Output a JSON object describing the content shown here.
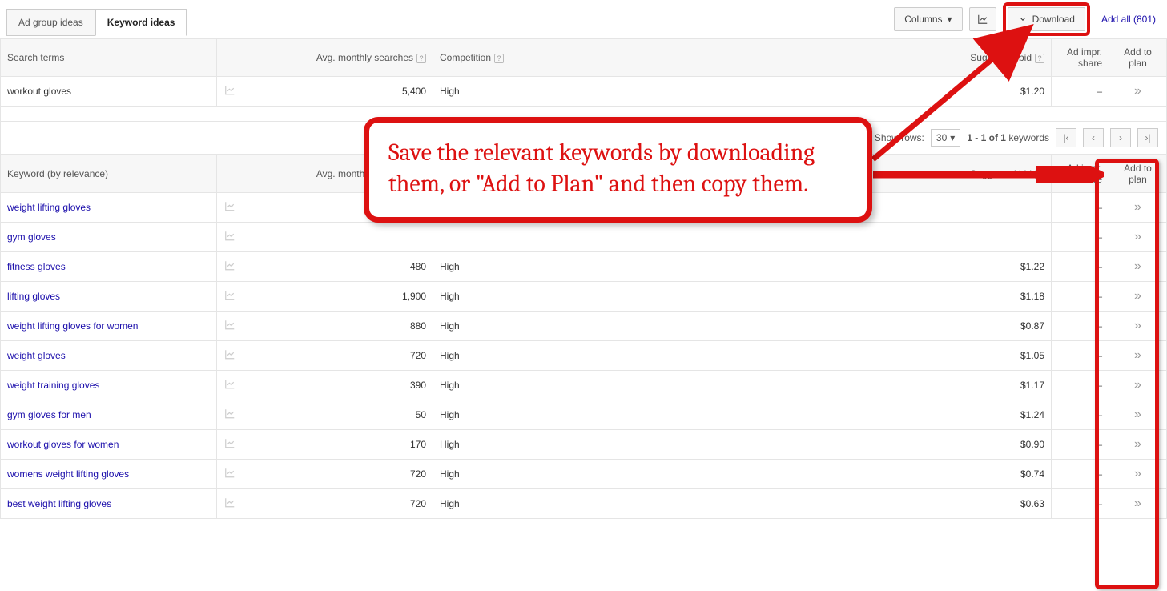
{
  "toolbar": {
    "tabs": {
      "ad_group": "Ad group ideas",
      "keyword": "Keyword ideas"
    },
    "columns_label": "Columns",
    "download_label": "Download",
    "add_all_label": "Add all (801)"
  },
  "headers": {
    "search_terms": "Search terms",
    "keyword_rel": "Keyword (by relevance)",
    "avg_searches": "Avg. monthly searches",
    "competition": "Competition",
    "suggested_bid": "Suggested bid",
    "ad_impr": "Ad impr. share",
    "add_to_plan": "Add to plan"
  },
  "search_terms_rows": [
    {
      "keyword": "workout gloves",
      "searches": "5,400",
      "competition": "High",
      "bid": "$1.20",
      "impr": "–"
    }
  ],
  "pager": {
    "show_rows_label": "Show rows:",
    "rows_value": "30",
    "range_text": "1 - 1 of 1",
    "suffix": "keywords"
  },
  "keyword_rows": [
    {
      "keyword": "weight lifting gloves",
      "searches": "",
      "competition": "",
      "bid": "",
      "impr": "–"
    },
    {
      "keyword": "gym gloves",
      "searches": "",
      "competition": "",
      "bid": "",
      "impr": "–"
    },
    {
      "keyword": "fitness gloves",
      "searches": "480",
      "competition": "High",
      "bid": "$1.22",
      "impr": "–"
    },
    {
      "keyword": "lifting gloves",
      "searches": "1,900",
      "competition": "High",
      "bid": "$1.18",
      "impr": "–"
    },
    {
      "keyword": "weight lifting gloves for women",
      "searches": "880",
      "competition": "High",
      "bid": "$0.87",
      "impr": "–"
    },
    {
      "keyword": "weight gloves",
      "searches": "720",
      "competition": "High",
      "bid": "$1.05",
      "impr": "–"
    },
    {
      "keyword": "weight training gloves",
      "searches": "390",
      "competition": "High",
      "bid": "$1.17",
      "impr": "–"
    },
    {
      "keyword": "gym gloves for men",
      "searches": "50",
      "competition": "High",
      "bid": "$1.24",
      "impr": "–"
    },
    {
      "keyword": "workout gloves for women",
      "searches": "170",
      "competition": "High",
      "bid": "$0.90",
      "impr": "–"
    },
    {
      "keyword": "womens weight lifting gloves",
      "searches": "720",
      "competition": "High",
      "bid": "$0.74",
      "impr": "–"
    },
    {
      "keyword": "best weight lifting gloves",
      "searches": "720",
      "competition": "High",
      "bid": "$0.63",
      "impr": "–"
    }
  ],
  "callout": {
    "text": "Save the relevant keywords by downloading them, or \"Add to Plan\" and then copy them."
  }
}
